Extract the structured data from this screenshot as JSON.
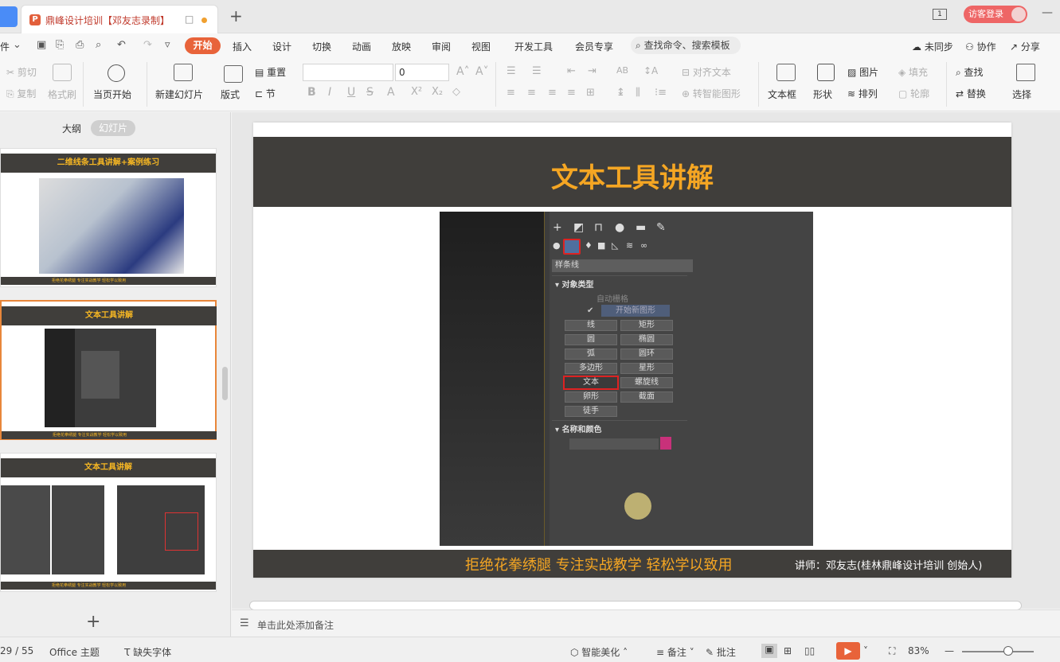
{
  "titlebar": {
    "doc_title": "鼎峰设计培训【邓友志录制】",
    "new_tab": "+",
    "window_badge": "1",
    "login": "访客登录",
    "minimize": "—"
  },
  "menu": {
    "file_partial": "件",
    "items": [
      "开始",
      "插入",
      "设计",
      "切换",
      "动画",
      "放映",
      "审阅",
      "视图",
      "开发工具",
      "会员专享"
    ],
    "search": "查找命令、搜索模板",
    "sync": "未同步",
    "collab": "协作",
    "share": "分享"
  },
  "ribbon": {
    "cut": "剪切",
    "copy": "复制",
    "format_painter": "格式刷",
    "play_from_current": "当页开始",
    "new_slide": "新建幻灯片",
    "layout": "版式",
    "reset": "重置",
    "section": "节",
    "font_size": "0",
    "align_text": "对齐文本",
    "smart_convert": "转智能图形",
    "textbox": "文本框",
    "shape": "形状",
    "picture": "图片",
    "fill": "填充",
    "arrange": "排列",
    "outline": "轮廓",
    "find": "查找",
    "replace": "替换",
    "select": "选择"
  },
  "leftpane": {
    "outline_tab": "大纲",
    "slides_tab": "幻灯片",
    "thumbs": [
      {
        "title": "二维线条工具讲解+案例练习",
        "footer": "拒绝花拳绣腿 专注实战教学 轻松学以致用"
      },
      {
        "title": "文本工具讲解",
        "footer": "拒绝花拳绣腿 专注实战教学 轻松学以致用"
      },
      {
        "title": "文本工具讲解",
        "footer": "拒绝花拳绣腿 专注实战教学 轻松学以致用"
      }
    ],
    "add": "+"
  },
  "slide": {
    "title": "文本工具讲解",
    "slogan": "拒绝花拳绣腿  专注实战教学  轻松学以致用",
    "lecturer": "讲师：邓友志(桂林鼎峰设计培训 创始人)",
    "panel": {
      "dropdown": "样条线",
      "section_object_type": "对象类型",
      "auto_grid": "自动栅格",
      "start_new_shape": "开始新图形",
      "buttons": [
        "线",
        "矩形",
        "圆",
        "椭圆",
        "弧",
        "圆环",
        "多边形",
        "星形",
        "文本",
        "螺旋线",
        "卵形",
        "截面",
        "徒手"
      ],
      "section_name_color": "名称和颜色"
    }
  },
  "notes": {
    "placeholder": "单击此处添加备注"
  },
  "status": {
    "page": "29 / 55",
    "theme": "Office 主题",
    "missing_font": "缺失字体",
    "beautify": "智能美化",
    "notes": "备注",
    "comments": "批注",
    "zoom": "83%"
  },
  "colors": {
    "accent": "#e8633a",
    "slide_dark": "#403e3b",
    "slide_gold": "#f5a623"
  }
}
